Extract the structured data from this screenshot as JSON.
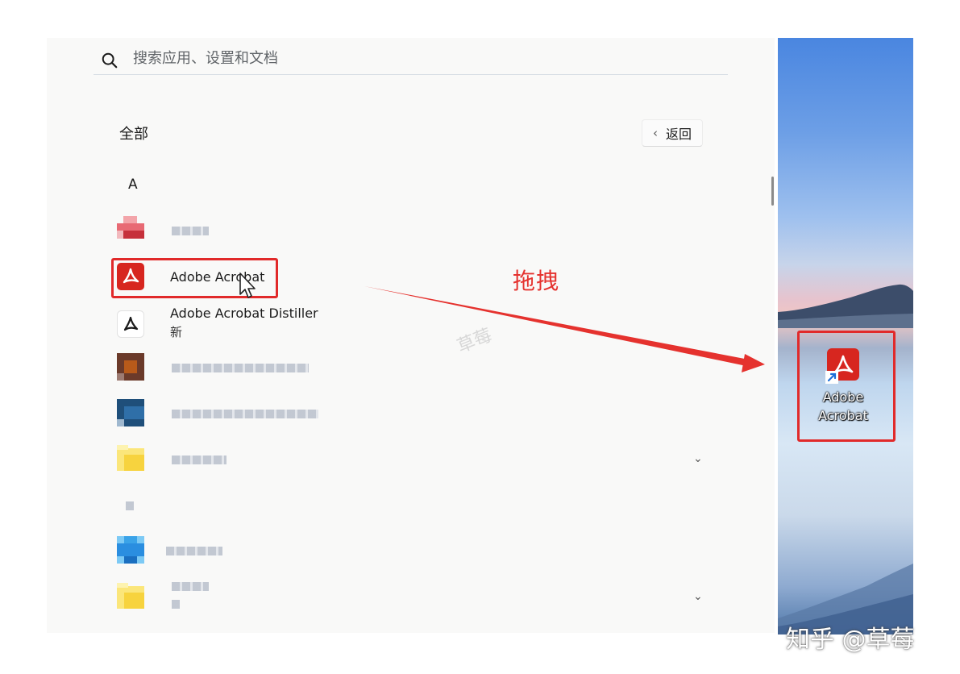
{
  "search": {
    "placeholder": "搜索应用、设置和文档",
    "icon": "search-icon"
  },
  "all_apps": {
    "section_title": "全部",
    "back_label": "返回",
    "letter_header": "A",
    "apps": [
      {
        "label": "",
        "blurred": true
      },
      {
        "label": "Adobe Acrobat",
        "icon": "adobe-acrobat-icon",
        "highlighted": true
      },
      {
        "label": "Adobe Acrobat Distiller",
        "sublabel": "新",
        "icon": "adobe-distiller-icon"
      },
      {
        "label": "",
        "blurred": true
      },
      {
        "label": "",
        "blurred": true
      },
      {
        "label": "",
        "blurred": true,
        "expandable": true
      },
      {
        "label": "",
        "blurred": true
      },
      {
        "label": "",
        "blurred": true
      },
      {
        "label": "",
        "blurred": true,
        "expandable": true
      }
    ]
  },
  "annotation": {
    "drag_text": "拖拽",
    "watermark_center": "草莓"
  },
  "desktop": {
    "shortcut_label_line1": "Adobe",
    "shortcut_label_line2": "Acrobat"
  },
  "watermark": "知乎 @草莓",
  "colors": {
    "accent_red": "#e12a2a",
    "acrobat_red": "#d7261f"
  }
}
